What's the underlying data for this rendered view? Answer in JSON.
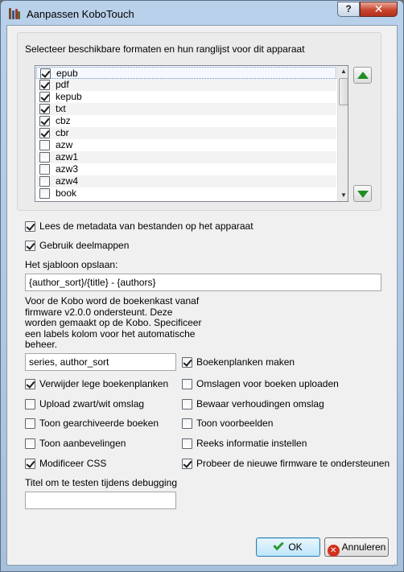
{
  "window": {
    "title": "Aanpassen KoboTouch",
    "help": "?",
    "close": "✕"
  },
  "formats": {
    "heading": "Selecteer beschikbare formaten en hun ranglijst voor dit apparaat",
    "items": [
      {
        "label": "epub",
        "checked": true
      },
      {
        "label": "pdf",
        "checked": true
      },
      {
        "label": "kepub",
        "checked": true
      },
      {
        "label": "txt",
        "checked": true
      },
      {
        "label": "cbz",
        "checked": true
      },
      {
        "label": "cbr",
        "checked": true
      },
      {
        "label": "azw",
        "checked": false
      },
      {
        "label": "azw1",
        "checked": false
      },
      {
        "label": "azw3",
        "checked": false
      },
      {
        "label": "azw4",
        "checked": false
      },
      {
        "label": "book",
        "checked": false
      }
    ]
  },
  "options": {
    "read_metadata": {
      "label": "Lees de metadata van bestanden op het apparaat",
      "checked": true
    },
    "subfolders": {
      "label": "Gebruik deelmappen",
      "checked": true
    },
    "template_label": "Het sjabloon opslaan:",
    "template_value": "{author_sort}/{title} - {authors}",
    "description": "Voor de Kobo word de boekenkast vanaf firmware v2.0.0 ondersteunt. Deze worden gemaakt op de Kobo. Specificeer een labels kolom voor het automatische beheer.",
    "columns_value": "series, author_sort",
    "create_shelves": {
      "label": "Boekenplanken maken",
      "checked": true
    },
    "delete_empty_shelves": {
      "label": "Verwijder lege boekenplanken",
      "checked": true
    },
    "upload_covers": {
      "label": "Omslagen voor boeken uploaden",
      "checked": false
    },
    "upload_grayscale": {
      "label": "Upload zwart/wit omslag",
      "checked": false
    },
    "keep_aspect": {
      "label": "Bewaar verhoudingen omslag",
      "checked": false
    },
    "show_archived": {
      "label": "Toon gearchiveerde boeken",
      "checked": false
    },
    "show_previews": {
      "label": "Toon voorbeelden",
      "checked": false
    },
    "show_recommendations": {
      "label": "Toon aanbevelingen",
      "checked": false
    },
    "series_info": {
      "label": "Reeks informatie instellen",
      "checked": false
    },
    "modify_css": {
      "label": "Modificeer CSS",
      "checked": true
    },
    "new_firmware": {
      "label": "Probeer de nieuwe firmware te ondersteunen",
      "checked": true
    },
    "debug_title_label": "Titel om te testen tijdens debugging",
    "debug_title_value": ""
  },
  "buttons": {
    "ok": "OK",
    "cancel": "Annuleren"
  },
  "colors": {
    "arrow_green": "#1f8e22",
    "close_red": "#c9452e",
    "cancel_red": "#d2311c"
  }
}
